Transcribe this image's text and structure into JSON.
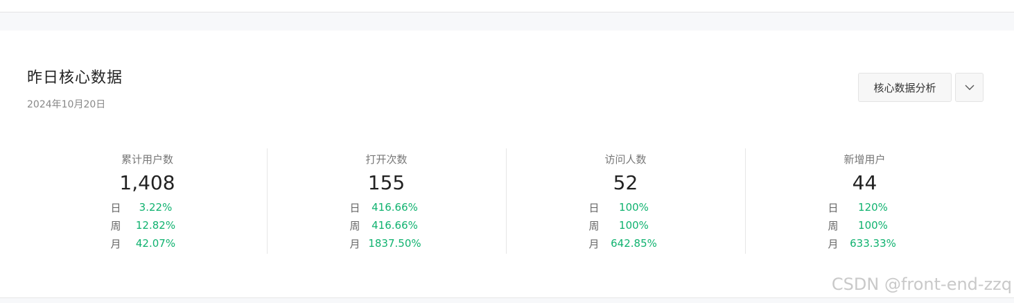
{
  "header": {
    "title": "昨日核心数据",
    "date": "2024年10月20日"
  },
  "actions": {
    "analysis_label": "核心数据分析",
    "dropdown_icon": "chevron-down-icon"
  },
  "metrics": [
    {
      "label": "累计用户数",
      "value": "1,408",
      "rows": [
        {
          "key": "日",
          "value": "3.22%"
        },
        {
          "key": "周",
          "value": "12.82%"
        },
        {
          "key": "月",
          "value": "42.07%"
        }
      ]
    },
    {
      "label": "打开次数",
      "value": "155",
      "rows": [
        {
          "key": "日",
          "value": "416.66%"
        },
        {
          "key": "周",
          "value": "416.66%"
        },
        {
          "key": "月",
          "value": "1837.50%"
        }
      ]
    },
    {
      "label": "访问人数",
      "value": "52",
      "rows": [
        {
          "key": "日",
          "value": "100%"
        },
        {
          "key": "周",
          "value": "100%"
        },
        {
          "key": "月",
          "value": "642.85%"
        }
      ]
    },
    {
      "label": "新增用户",
      "value": "44",
      "rows": [
        {
          "key": "日",
          "value": "120%"
        },
        {
          "key": "周",
          "value": "100%"
        },
        {
          "key": "月",
          "value": "633.33%"
        }
      ]
    }
  ],
  "colors": {
    "positive": "#0fb26f",
    "watermark": "#c9c9c9"
  },
  "watermark": "CSDN @front-end-zzq"
}
